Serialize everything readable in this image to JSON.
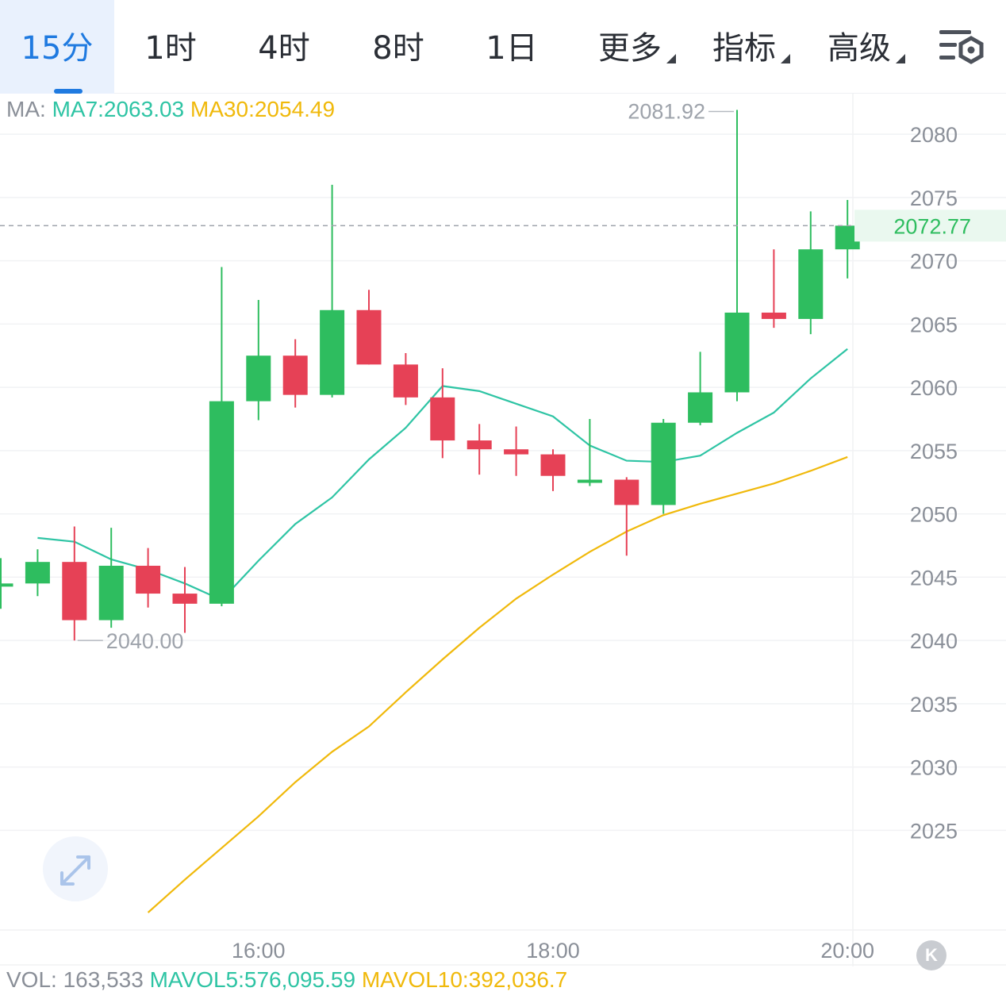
{
  "tabs": [
    {
      "label": "15分",
      "active": true
    },
    {
      "label": "1时"
    },
    {
      "label": "4时"
    },
    {
      "label": "8时"
    },
    {
      "label": "1日"
    },
    {
      "label": "更多",
      "dropdown": true
    },
    {
      "label": "指标",
      "dropdown": true
    },
    {
      "label": "高级",
      "dropdown": true
    }
  ],
  "icons": {
    "settings": "chart-settings-icon",
    "fullscreen": "expand-arrows-icon",
    "kline": "k-badge-icon"
  },
  "ma_legend": {
    "prefix": "MA:",
    "ma7": "MA7:2063.03",
    "ma30": "MA30:2054.49"
  },
  "vol_legend": {
    "vol": "VOL: 163,533",
    "mavol5": "MAVOL5:576,095.59",
    "mavol10": "MAVOL10:392,036.7"
  },
  "k_badge": "K",
  "colors": {
    "up": "#2ebd5f",
    "down": "#e64156",
    "ma7": "#2ec4a4",
    "ma30": "#f0b90b",
    "accent": "#1f7ae0",
    "last_price_label": "#2ebd5f"
  },
  "chart_data": {
    "type": "candlestick",
    "interval": "15分",
    "x_tick_labels": [
      {
        "label": "16:00",
        "index": 7
      },
      {
        "label": "18:00",
        "index": 15
      },
      {
        "label": "20:00",
        "index": 23
      }
    ],
    "y_ticks": [
      2080,
      2075,
      2070,
      2065,
      2060,
      2055,
      2050,
      2045,
      2040,
      2035,
      2030,
      2025
    ],
    "ylim": [
      2018.5,
      2090.6
    ],
    "last_price": "2072.77",
    "high_marker": {
      "label": "2081.92",
      "value": 2081.92,
      "index": 20
    },
    "low_marker": {
      "label": "2040.00",
      "value": 2040.0,
      "index": 2
    },
    "candles": [
      {
        "o": 2044.5,
        "c": 2044.5,
        "h": 2046.5,
        "l": 2042.5
      },
      {
        "o": 2044.5,
        "c": 2046.2,
        "h": 2047.2,
        "l": 2043.5
      },
      {
        "o": 2046.2,
        "c": 2041.6,
        "h": 2049.0,
        "l": 2040.0
      },
      {
        "o": 2041.6,
        "c": 2045.9,
        "h": 2048.9,
        "l": 2041.0
      },
      {
        "o": 2045.9,
        "c": 2043.7,
        "h": 2047.3,
        "l": 2042.6
      },
      {
        "o": 2043.7,
        "c": 2042.9,
        "h": 2045.8,
        "l": 2040.6
      },
      {
        "o": 2042.9,
        "c": 2058.9,
        "h": 2069.5,
        "l": 2042.7
      },
      {
        "o": 2058.9,
        "c": 2062.5,
        "h": 2066.9,
        "l": 2057.4
      },
      {
        "o": 2062.5,
        "c": 2059.4,
        "h": 2063.8,
        "l": 2058.4
      },
      {
        "o": 2059.4,
        "c": 2066.1,
        "h": 2076.0,
        "l": 2059.2
      },
      {
        "o": 2066.1,
        "c": 2061.8,
        "h": 2067.7,
        "l": 2061.8
      },
      {
        "o": 2061.8,
        "c": 2059.2,
        "h": 2062.7,
        "l": 2058.6
      },
      {
        "o": 2059.2,
        "c": 2055.8,
        "h": 2061.5,
        "l": 2054.4
      },
      {
        "o": 2055.8,
        "c": 2055.1,
        "h": 2057.1,
        "l": 2053.1
      },
      {
        "o": 2055.1,
        "c": 2054.7,
        "h": 2056.9,
        "l": 2053.0
      },
      {
        "o": 2054.7,
        "c": 2053.0,
        "h": 2055.1,
        "l": 2051.8
      },
      {
        "o": 2052.7,
        "c": 2052.7,
        "h": 2057.5,
        "l": 2052.2
      },
      {
        "o": 2052.7,
        "c": 2050.7,
        "h": 2052.9,
        "l": 2046.7
      },
      {
        "o": 2050.7,
        "c": 2057.2,
        "h": 2057.5,
        "l": 2050.0
      },
      {
        "o": 2057.2,
        "c": 2059.6,
        "h": 2062.8,
        "l": 2057.0
      },
      {
        "o": 2059.6,
        "c": 2065.9,
        "h": 2081.92,
        "l": 2058.9
      },
      {
        "o": 2065.9,
        "c": 2065.4,
        "h": 2070.9,
        "l": 2064.7
      },
      {
        "o": 2065.4,
        "c": 2070.9,
        "h": 2073.9,
        "l": 2064.2
      },
      {
        "o": 2070.9,
        "c": 2072.77,
        "h": 2074.8,
        "l": 2068.6
      }
    ],
    "ma7": [
      2048.1,
      2047.8,
      2046.4,
      2045.6,
      2044.5,
      2043.2,
      2046.3,
      2049.2,
      2051.3,
      2054.3,
      2056.8,
      2060.1,
      2059.7,
      2058.7,
      2057.7,
      2055.4,
      2054.2,
      2054.1,
      2054.6,
      2056.4,
      2058.0,
      2060.7,
      2063.03
    ],
    "ma30": [
      2018.5,
      2021.1,
      2023.6,
      2026.1,
      2028.8,
      2031.2,
      2033.2,
      2035.9,
      2038.5,
      2041.0,
      2043.3,
      2045.2,
      2047.0,
      2048.6,
      2049.9,
      2050.8,
      2051.6,
      2052.4,
      2053.4,
      2054.49
    ]
  }
}
